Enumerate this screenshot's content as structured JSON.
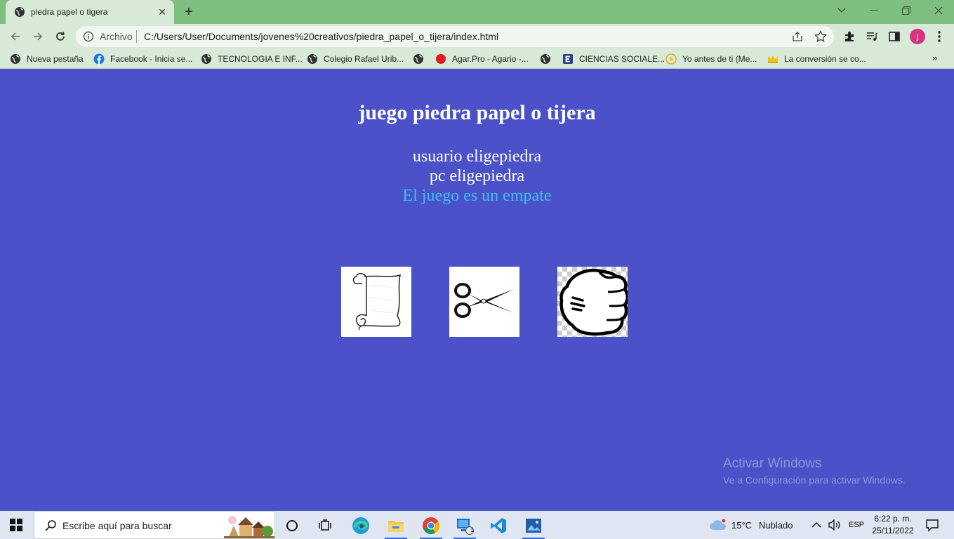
{
  "browser": {
    "tab_title": "piedra papel o tigera",
    "address_scheme": "Archivo",
    "address_url": "C:/Users/User/Documents/jovenes%20creativos/piedra_papel_o_tijera/index.html",
    "avatar_letter": "j"
  },
  "bookmarks": [
    {
      "label": "Nueva pestaña",
      "icon": "globe-icon"
    },
    {
      "label": "Facebook - Inicia se...",
      "icon": "facebook-icon"
    },
    {
      "label": "TECNOLOGIA E INF...",
      "icon": "globe-icon"
    },
    {
      "label": "Colegio Rafael Urib...",
      "icon": "globe-icon"
    },
    {
      "label": "",
      "icon": "globe-icon"
    },
    {
      "label": "Agar.Pro - Agario -...",
      "icon": "red-circle-icon"
    },
    {
      "label": "",
      "icon": "globe-icon"
    },
    {
      "label": "CIENCIAS SOCIALE...",
      "icon": "e-book-icon"
    },
    {
      "label": "Yo antes de ti (Me...",
      "icon": "play-icon"
    },
    {
      "label": "La conversión se co...",
      "icon": "crown-icon"
    }
  ],
  "bookmarks_more": "»",
  "page": {
    "title": "juego piedra papel o tijera",
    "user_choice": "usuario eligepiedra",
    "pc_choice": "pc eligepiedra",
    "result": "El juego es un empate",
    "choices": [
      {
        "name": "papel",
        "icon": "paper-scroll-icon"
      },
      {
        "name": "tijera",
        "icon": "scissors-icon"
      },
      {
        "name": "piedra",
        "icon": "fist-icon"
      }
    ]
  },
  "watermark": {
    "title": "Activar Windows",
    "subtitle": "Ve a Configuración para activar Windows."
  },
  "taskbar": {
    "search_placeholder": "Escribe aquí para buscar",
    "weather_temp": "15°C",
    "weather_desc": "Nublado",
    "language": "ESP",
    "time": "6:22 p. m.",
    "date": "25/11/2022",
    "badge_count": "1"
  },
  "colors": {
    "page_background": "#4b52c9",
    "result_text": "#3fc0ef",
    "tabstrip": "#7cbf7e",
    "toolbar": "#d7ead8"
  }
}
